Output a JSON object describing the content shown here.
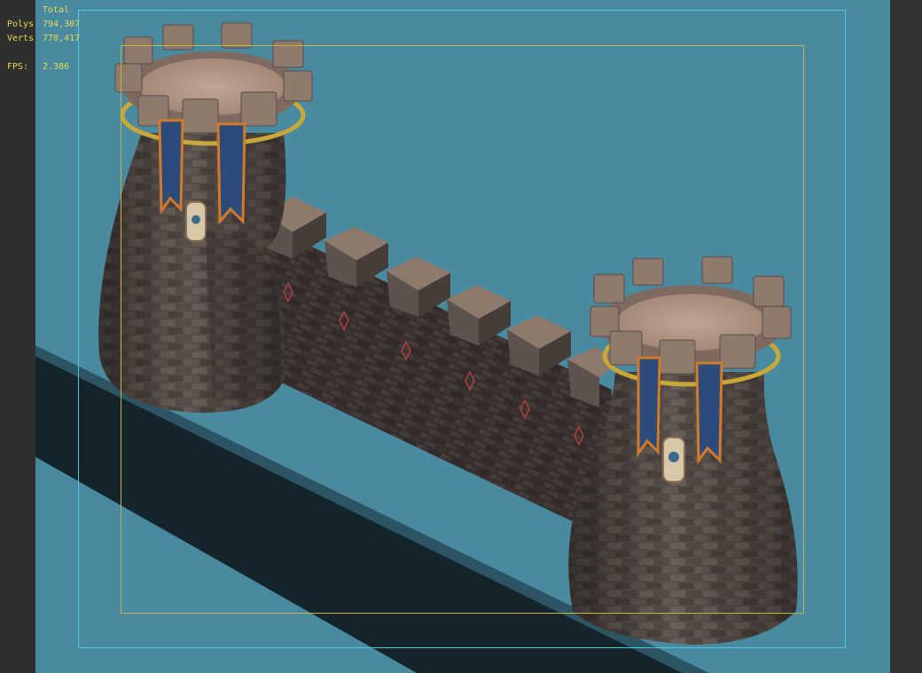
{
  "viewport": {
    "stats": {
      "header": "Total",
      "polys_label": "Polys",
      "polys_value": "794,307",
      "verts_label": "Verts",
      "verts_value": "778,417",
      "fps_label": "FPS:",
      "fps_value": "2.386"
    },
    "colors": {
      "background": "#4a8aa0",
      "stats_text": "#e8d850",
      "safe_frame_outer": "#4cc8e0",
      "safe_frame_inner": "#c8b040",
      "shadow": "#13242a",
      "stone": "#5e5450",
      "tower_top": "#b89a88",
      "banner_blue": "#2c4b7a",
      "banner_trim": "#d07a2a",
      "gold_ring": "#c8a838"
    }
  }
}
